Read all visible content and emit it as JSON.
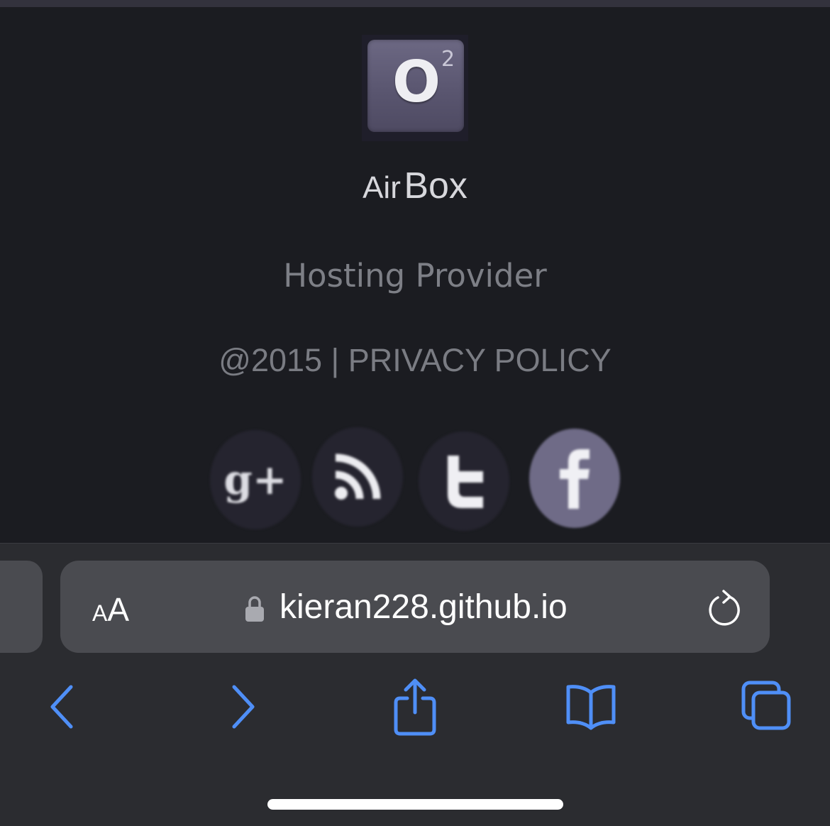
{
  "site": {
    "logo": {
      "letter": "O",
      "superscript": "2"
    },
    "brand": {
      "part1": "Air",
      "part2": "Box"
    },
    "tagline": "Hosting Provider",
    "footer": "@2015 | PRIVACY POLICY",
    "social": [
      {
        "icon": "google-plus-icon",
        "glyph": "g+"
      },
      {
        "icon": "rss-icon",
        "glyph": "rss"
      },
      {
        "icon": "twitter-icon",
        "glyph": "t"
      },
      {
        "icon": "facebook-icon",
        "glyph": "f"
      }
    ]
  },
  "browser": {
    "reader_label_small": "A",
    "reader_label_big": "A",
    "url": "kieran228.github.io",
    "accent_color": "#4f8ff7",
    "toolbar": [
      {
        "icon": "back-icon"
      },
      {
        "icon": "forward-icon"
      },
      {
        "icon": "share-icon"
      },
      {
        "icon": "bookmarks-icon"
      },
      {
        "icon": "tabs-icon"
      }
    ]
  }
}
